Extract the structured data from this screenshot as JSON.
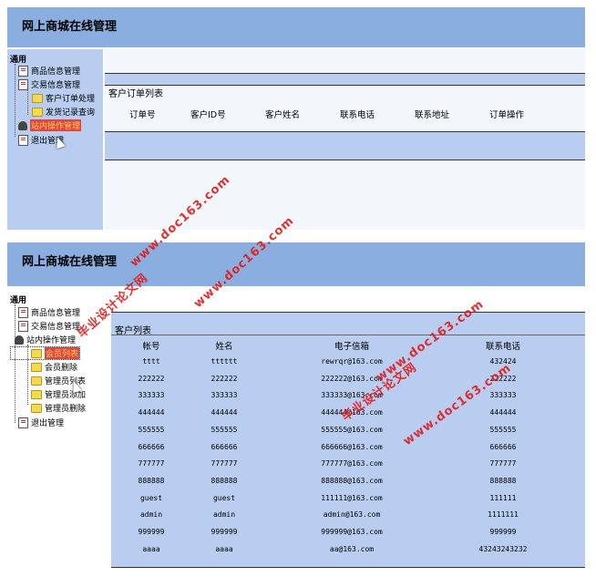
{
  "top": {
    "title": "网上商城在线管理",
    "sidebar": {
      "section": "通用",
      "items": [
        {
          "label": "商品信息管理",
          "icon": "document-icon"
        },
        {
          "label": "交易信息管理",
          "icon": "document-icon"
        },
        {
          "label": "客户订单处理",
          "icon": "folder-icon"
        },
        {
          "label": "发货记录查询",
          "icon": "folder-icon"
        },
        {
          "label": "站内操作管理",
          "icon": "user-group-icon"
        },
        {
          "label": "退出管理",
          "icon": "document-icon"
        }
      ]
    },
    "main": {
      "title": "客户订单列表",
      "columns": [
        "订单号",
        "客户ID号",
        "客户姓名",
        "联系电话",
        "联系地址",
        "订单操作"
      ]
    }
  },
  "bottom": {
    "title": "网上商城在线管理",
    "sidebar": {
      "section": "通用",
      "items": [
        {
          "label": "商品信息管理",
          "icon": "document-icon"
        },
        {
          "label": "交易信息管理",
          "icon": "document-icon"
        },
        {
          "label": "站内操作管理",
          "icon": "user-group-icon"
        },
        {
          "label": "会员列表",
          "icon": "folder-icon"
        },
        {
          "label": "会员删除",
          "icon": "folder-icon"
        },
        {
          "label": "管理员列表",
          "icon": "folder-icon"
        },
        {
          "label": "管理员添加",
          "icon": "folder-icon"
        },
        {
          "label": "管理员删除",
          "icon": "folder-icon"
        },
        {
          "label": "退出管理",
          "icon": "document-icon"
        }
      ]
    },
    "main": {
      "title": "客户列表",
      "columns": [
        "帐号",
        "姓名",
        "电子信箱",
        "联系电话"
      ],
      "rows": [
        [
          "tttt",
          "tttttt",
          "rewrqr@163.com",
          "432424"
        ],
        [
          "222222",
          "222222",
          "222222@163.com",
          "222222"
        ],
        [
          "333333",
          "333333",
          "333333@163.com",
          "333333"
        ],
        [
          "444444",
          "444444",
          "444444@163.com",
          "444444"
        ],
        [
          "555555",
          "555555",
          "555555@163.com",
          "555555"
        ],
        [
          "666666",
          "666666",
          "666666@163.com",
          "666666"
        ],
        [
          "777777",
          "777777",
          "777777@163.com",
          "777777"
        ],
        [
          "888888",
          "888888",
          "888888@163.com",
          "888888"
        ],
        [
          "guest",
          "guest",
          "111111@163.com",
          "111111"
        ],
        [
          "admin",
          "admin",
          "admin@163.com",
          "1111111"
        ],
        [
          "999999",
          "999999",
          "999999@163.com",
          "999999"
        ],
        [
          "aaaa",
          "aaaa",
          "aa@163.com",
          "43243243232"
        ]
      ]
    }
  },
  "watermarks": {
    "site": "毕业设计论文网",
    "url": "www.doc163.com"
  },
  "colors": {
    "header": "#8aaedf",
    "sidebar": "#b9cdf0",
    "highlight": "#e04545",
    "watermark": "#e21b1b"
  }
}
